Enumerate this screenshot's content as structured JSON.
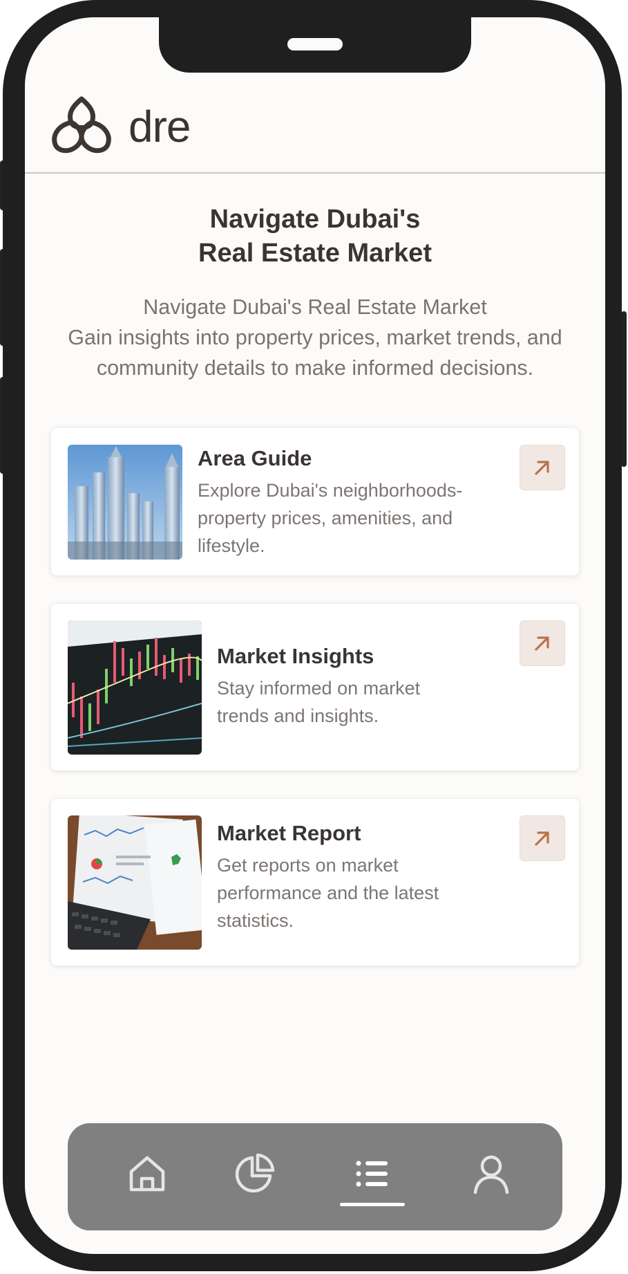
{
  "app": {
    "logo_text": "dre"
  },
  "hero": {
    "title_line1": "Navigate Dubai's",
    "title_line2": "Real Estate Market",
    "subtitle_line1": "Navigate Dubai's Real Estate Market",
    "subtitle_line2": "Gain insights into property prices, market trends, and",
    "subtitle_line3": "community details to make informed decisions."
  },
  "cards": [
    {
      "title": "Area Guide",
      "desc_line1": "Explore Dubai's neighborhoods-",
      "desc_line2": "property prices, amenities, and",
      "desc_line3": "lifestyle.",
      "image": "dubai-skyline-image",
      "action_icon": "arrow-up-right-icon"
    },
    {
      "title": "Market Insights",
      "desc_line1": "Stay informed on market",
      "desc_line2": "trends and insights.",
      "image": "stock-chart-image",
      "action_icon": "arrow-up-right-icon"
    },
    {
      "title": "Market Report",
      "desc_line1": "Get reports on market",
      "desc_line2": "performance and the latest",
      "desc_line3": "statistics.",
      "image": "report-laptop-image",
      "action_icon": "arrow-up-right-icon"
    }
  ],
  "tabbar": {
    "items": [
      {
        "name": "home",
        "icon": "home-icon"
      },
      {
        "name": "analytics",
        "icon": "pie-chart-icon"
      },
      {
        "name": "list",
        "icon": "list-icon",
        "active": true
      },
      {
        "name": "profile",
        "icon": "user-icon"
      }
    ]
  },
  "colors": {
    "accent": "#b8734a",
    "arrow_bg": "#f1e8e3",
    "tabbar_bg": "#808080",
    "text_dark": "#3a3532",
    "text_muted": "#7a7370"
  }
}
